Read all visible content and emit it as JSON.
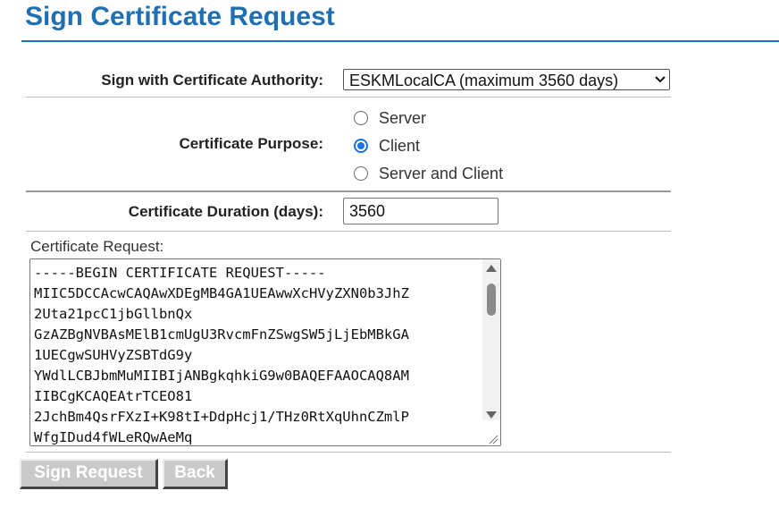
{
  "page": {
    "title": "Sign Certificate Request"
  },
  "form": {
    "ca_label": "Sign with Certificate Authority:",
    "ca_selected": "ESKMLocalCA (maximum 3560 days)",
    "purpose_label": "Certificate Purpose:",
    "purpose_options": [
      {
        "label": "Server",
        "checked": false
      },
      {
        "label": "Client",
        "checked": true
      },
      {
        "label": "Server and Client",
        "checked": false
      }
    ],
    "duration_label": "Certificate Duration (days):",
    "duration_value": "3560",
    "request_label": "Certificate Request:",
    "request_text": "-----BEGIN CERTIFICATE REQUEST-----\nMIIC5DCCAcwCAQAwXDEgMB4GA1UEAwwXcHVyZXN0b3JhZ\n2Uta21pcC1jbGllbnQx\nGzAZBgNVBAsMElB1cmUgU3RvcmFnZSwgSW5jLjEbMBkGA\n1UECgwSUHVyZSBTdG9y\nYWdlLCBJbmMuMIIBIjANBgkqhkiG9w0BAQEFAAOCAQ8AM\nIIBCgKCAQEAtrTCEO81\n2JchBm4QsrFXzI+K98tI+DdpHcj1/THz0RtXqUhnCZmlP\nWfgIDud4fWLeRQwAeMq"
  },
  "buttons": {
    "sign_label": "Sign Request",
    "back_label": "Back"
  }
}
